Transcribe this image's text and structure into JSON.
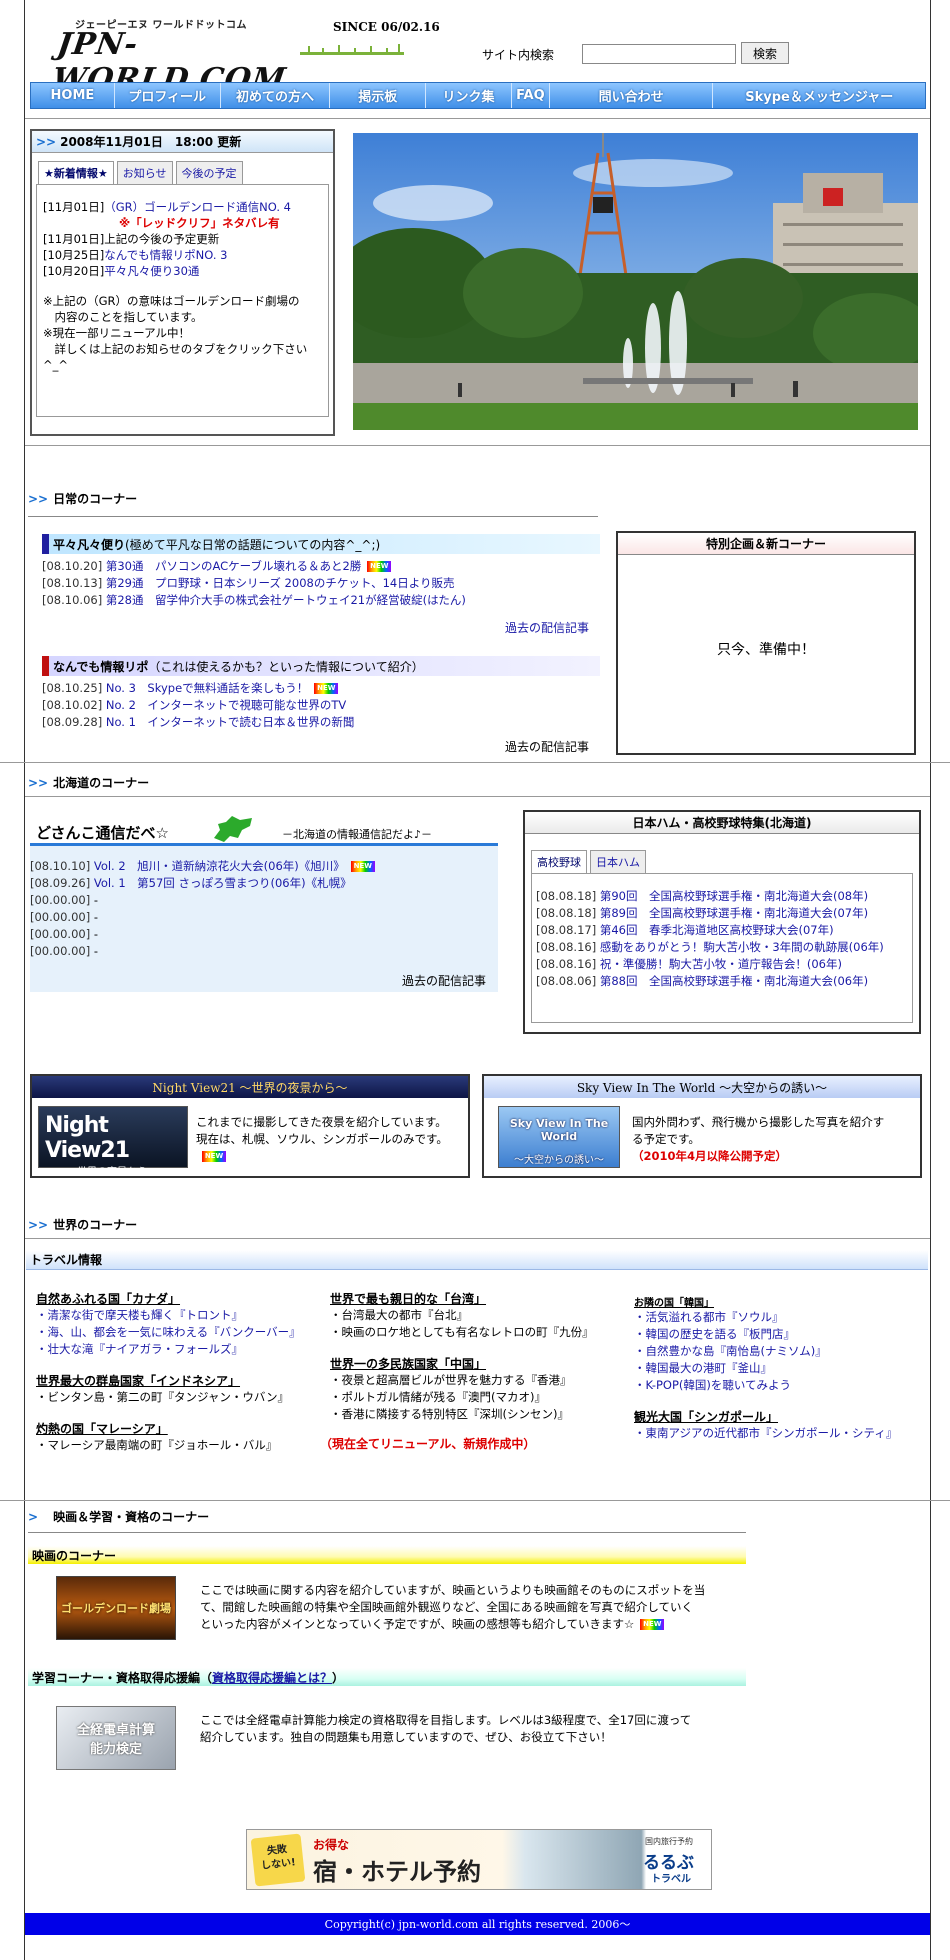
{
  "header": {
    "logo_kana": "ジェーピーエヌ ワールドドットコム",
    "logo_text": "JPN-WORLD.COM",
    "since": "SINCE 06/02.16",
    "search_label": "サイト内検索",
    "search_value": "",
    "search_button": "検索"
  },
  "nav": [
    "HOME",
    "プロフィール",
    "初めての方へ",
    "掲示板",
    "リンク集",
    "FAQ",
    "問い合わせ",
    "Skype＆メッセンジャー"
  ],
  "news": {
    "updated": "2008年11月01日　18:00 更新",
    "tabs": [
      "★新着情報★",
      "お知らせ",
      "今後の予定"
    ],
    "items": [
      {
        "date": "[11月01日]",
        "text": "（GR）ゴールデンロード通信NO. 4",
        "link": true
      },
      {
        "date": "",
        "text": "※「レッドクリフ」ネタバレ有",
        "link": false,
        "red": true
      },
      {
        "date": "[11月01日]",
        "text": "上記の今後の予定更新",
        "link": false
      },
      {
        "date": "[10月25日]",
        "text": "なんでも情報リポNO. 3",
        "link": true
      },
      {
        "date": "[10月20日]",
        "text": "平々凡々便り30通",
        "link": true
      }
    ],
    "notes": [
      "※上記の（GR）の意味はゴールデンロード劇場の",
      "　内容のことを指しています。",
      "※現在一部リニューアル中！",
      "　詳しくは上記のお知らせのタブをクリック下さい",
      "^_^"
    ]
  },
  "daily": {
    "title": "日常のコーナー",
    "heibon_title": "平々凡々便り",
    "heibon_sub": "(極めて平凡な日常の話題についての内容^_^;)",
    "heibon": [
      {
        "date": "[08.10.20]",
        "text": "第30通　パソコンのACケーブル壊れる＆あと2勝",
        "new": true
      },
      {
        "date": "[08.10.13]",
        "text": "第29通　プロ野球・日本シリーズ 2008のチケット、14日より販売",
        "new": false
      },
      {
        "date": "[08.10.06]",
        "text": "第28通　留学仲介大手の株式会社ゲートウェイ21が経営破綻(はたん)",
        "new": false
      }
    ],
    "past": "過去の配信記事",
    "nandemo_title": "なんでも情報リポ",
    "nandemo_sub": "（これは使えるかも？といった情報について紹介）",
    "nandemo": [
      {
        "date": "[08.10.25]",
        "text": "No. 3　Skypeで無料通話を楽しもう！",
        "new": true
      },
      {
        "date": "[08.10.02]",
        "text": "No. 2　インターネットで視聴可能な世界のTV",
        "new": false
      },
      {
        "date": "[08.09.28]",
        "text": "No. 1　インターネットで読む日本＆世界の新聞",
        "new": false
      }
    ],
    "special_title": "特別企画＆新コーナー",
    "special_body": "只今、準備中！"
  },
  "hokkaido": {
    "title": "北海道のコーナー",
    "dosanko_title": "どさんこ通信だべ☆",
    "dosanko_sub": "－北海道の情報通信記だよ♪－",
    "dosanko": [
      {
        "date": "[08.10.10]",
        "text": "Vol. 2　旭川・道新納涼花火大会(06年)《旭川》",
        "new": true
      },
      {
        "date": "[08.09.26]",
        "text": "Vol. 1　第57回 さっぽろ雪まつり(06年)《札幌》",
        "new": false
      },
      {
        "date": "[00.00.00]",
        "text": "-",
        "new": false
      },
      {
        "date": "[00.00.00]",
        "text": "-",
        "new": false
      },
      {
        "date": "[00.00.00]",
        "text": "-",
        "new": false
      },
      {
        "date": "[00.00.00]",
        "text": "-",
        "new": false
      }
    ],
    "past": "過去の配信記事",
    "baseball_title": "日本ハム・高校野球特集(北海道)",
    "baseball_tabs": [
      "高校野球",
      "日本ハム"
    ],
    "baseball": [
      {
        "date": "[08.08.18]",
        "text": "第90回　全国高校野球選手権・南北海道大会(08年)"
      },
      {
        "date": "[08.08.18]",
        "text": "第89回　全国高校野球選手権・南北海道大会(07年)"
      },
      {
        "date": "[08.08.17]",
        "text": "第46回　春季北海道地区高校野球大会(07年)"
      },
      {
        "date": "[08.08.16]",
        "text": "感動をありがとう！駒大苫小牧・3年間の軌跡展(06年)"
      },
      {
        "date": "[08.08.16]",
        "text": "祝・準優勝！駒大苫小牧・道庁報告会！(06年)"
      },
      {
        "date": "[08.08.06]",
        "text": "第88回　全国高校野球選手権・南北海道大会(06年)"
      }
    ]
  },
  "night": {
    "head": "Night View21 ～世界の夜景から～",
    "thumb_main": "Night View21",
    "thumb_sub": "～世界の夜景から～",
    "text1": "これまでに撮影してきた夜景を紹介しています。",
    "text2": "現在は、札幌、ソウル、シンガポールのみです。"
  },
  "sky": {
    "head": "Sky View In The World ～大空からの誘い～",
    "thumb_main": "Sky View In The World",
    "thumb_sub": "～大空からの誘い～",
    "text1": "国内外問わず、飛行機から撮影した写真を紹介す",
    "text2": "る予定です。",
    "text3": "（2010年4月以降公開予定）"
  },
  "world": {
    "title": "世界のコーナー",
    "travel": "トラベル情報",
    "col1": [
      {
        "title": "自然あふれる国「カナダ」",
        "items": [
          "・清潔な街で摩天楼も輝く『トロント』",
          "・海、山、都会を一気に味わえる『バンクーバー』",
          "・壮大な滝『ナイアガラ・フォールズ』"
        ]
      },
      {
        "title": "世界最大の群島国家「インドネシア」",
        "items": [
          "・ビンタン島・第二の町『タンジャン・ウバン』"
        ]
      },
      {
        "title": "灼熱の国「マレーシア」",
        "items": [
          "・マレーシア最南端の町『ジョホール・バル』"
        ]
      }
    ],
    "col2": [
      {
        "title": "世界で最も親日的な「台湾」",
        "items": [
          "・台湾最大の都市『台北』",
          "・映画のロケ地としても有名なレトロの町『九份』"
        ]
      },
      {
        "title": "世界一の多民族国家「中国」",
        "items": [
          "・夜景と超高層ビルが世界を魅力する『香港』",
          "・ポルトガル情緒が残る『澳門(マカオ)』",
          "・香港に隣接する特別特区『深圳(シンセン)』"
        ]
      }
    ],
    "col2_note": "（現在全てリニューアル、新規作成中）",
    "col3": [
      {
        "title": "お隣の国「韓国」",
        "items": [
          "・活気溢れる都市『ソウル』",
          "・韓国の歴史を語る『板門店』",
          "・自然豊かな島『南怡島(ナミソム)』",
          "・韓国最大の港町『釜山』",
          "・K-POP(韓国)を聴いてみよう"
        ]
      },
      {
        "title": "観光大国「シンガポール」",
        "items": [
          "・東南アジアの近代都市『シンガポール・シティ』"
        ]
      }
    ]
  },
  "movie": {
    "title": "映画＆学習・資格のコーナー",
    "movie_bar": "映画のコーナー",
    "movie_thumb": "ゴールデンロード劇場",
    "movie_text1": "ここでは映画に関する内容を紹介していますが、映画というよりも映画館そのものにスポットを当",
    "movie_text2": "て、間館した映画館の特集や全国映画館外観巡りなど、全国にある映画館を写真で紹介していく",
    "movie_text3": "といった内容がメインとなっていく予定ですが、映画の感想等も紹介していきます☆",
    "study_bar": "学習コーナー・資格取得応援編（",
    "study_link": "資格取得応援編とは？",
    "study_bar_end": "）",
    "study_thumb1": "全経電卓計算",
    "study_thumb2": "能力検定",
    "study_text1": "ここでは全経電卓計算能力検定の資格取得を目指します。レベルは3級程度で、全17回に渡って",
    "study_text2": "紹介しています。独自の問題集も用意していますので、ぜひ、お役立て下さい！"
  },
  "ad": {
    "small1": "失敗",
    "small2": "しない!",
    "pre": "お得な",
    "main": "宿・ホテル予約",
    "tag": "国内旅行予約",
    "brand": "るるぶ",
    "brand2": "トラベル"
  },
  "footer": "Copyright(c) jpn-world.com all rights reserved. 2006～",
  "colors": {
    "nav": "#3f8fe8",
    "link": "#1a1aa6",
    "footer": "#0000e8",
    "red": "#d00000"
  }
}
